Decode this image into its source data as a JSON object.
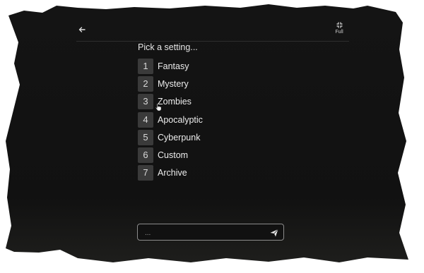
{
  "header": {
    "back_icon": "arrow-left-icon",
    "fullscreen_icon": "fullscreen-icon",
    "fullscreen_label": "Full"
  },
  "prompt": "Pick a setting...",
  "options": [
    {
      "number": "1",
      "label": "Fantasy"
    },
    {
      "number": "2",
      "label": "Mystery"
    },
    {
      "number": "3",
      "label": "Zombies"
    },
    {
      "number": "4",
      "label": "Apocalyptic"
    },
    {
      "number": "5",
      "label": "Cyberpunk"
    },
    {
      "number": "6",
      "label": "Custom"
    },
    {
      "number": "7",
      "label": "Archive"
    }
  ],
  "composer": {
    "placeholder": "...",
    "value": "",
    "send_icon": "send-icon"
  },
  "colors": {
    "background": "#111111",
    "option_badge": "#3a3a3a",
    "text": "#ededed",
    "input_border": "#8c8c8c"
  }
}
